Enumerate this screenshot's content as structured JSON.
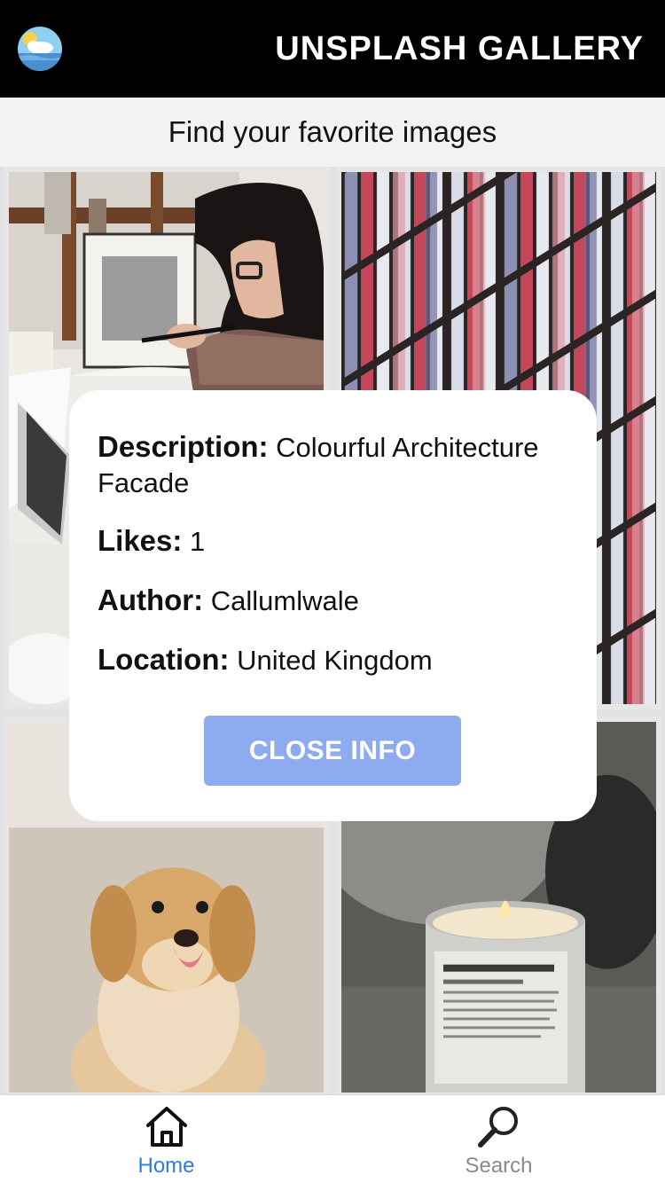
{
  "header": {
    "title": "UNSPLASH GALLERY",
    "logo_icon": "weather-cloud-sun-icon"
  },
  "subheader": {
    "text": "Find your favorite images"
  },
  "gallery": {
    "images": [
      {
        "subject": "woman-drawing-at-desk"
      },
      {
        "subject": "colourful-architecture-facade"
      },
      {
        "subject": "golden-retriever-puppy"
      },
      {
        "subject": "soy-candle-in-tin"
      }
    ]
  },
  "info_modal": {
    "description_label": "Description:",
    "description_value": "Colourful Architecture Facade",
    "likes_label": "Likes:",
    "likes_value": "1",
    "author_label": "Author:",
    "author_value": "Callumlwale",
    "location_label": "Location:",
    "location_value": "United Kingdom",
    "close_label": "CLOSE INFO"
  },
  "tabbar": {
    "active": "Home",
    "tabs": [
      {
        "label": "Home",
        "icon": "home-icon",
        "color": "#2f7be6"
      },
      {
        "label": "Search",
        "icon": "search-icon",
        "color": "#8a8a8a"
      }
    ]
  },
  "colors": {
    "header_bg": "#000000",
    "button_bg": "#8eabf0",
    "active_tab": "#2f7be6"
  }
}
